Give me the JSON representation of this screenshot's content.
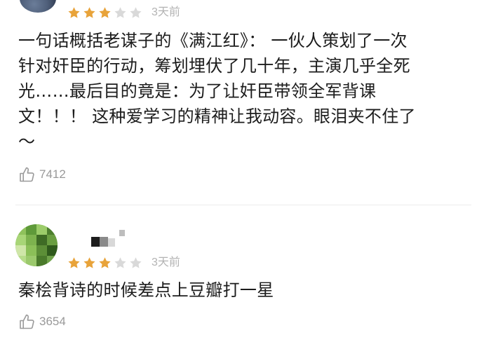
{
  "colors": {
    "star_filled": "#e8a33a",
    "star_empty": "#d9d9d9",
    "muted_text": "#b3b3b3",
    "body_text": "#1c1c1c"
  },
  "reviews": [
    {
      "rating": 3,
      "max_rating": 5,
      "time": "3天前",
      "comment_lines": [
        "一句话概括老谋子的《满江红》：  一伙人策划了一次",
        "针对奸臣的行动，筹划埋伏了几十年，主演几乎全死",
        "光……最后目的竟是：为了让奸臣带领全军背课",
        "文！！！  这种爱学习的精神让我动容。眼泪夹不住了",
        "～"
      ],
      "like_icon": "thumbs-up-icon",
      "like_count": "7412"
    },
    {
      "rating": 3,
      "max_rating": 5,
      "time": "3天前",
      "comment_lines": [
        "秦桧背诗的时候差点上豆瓣打一星"
      ],
      "like_icon": "thumbs-up-icon",
      "like_count": "3654"
    }
  ]
}
